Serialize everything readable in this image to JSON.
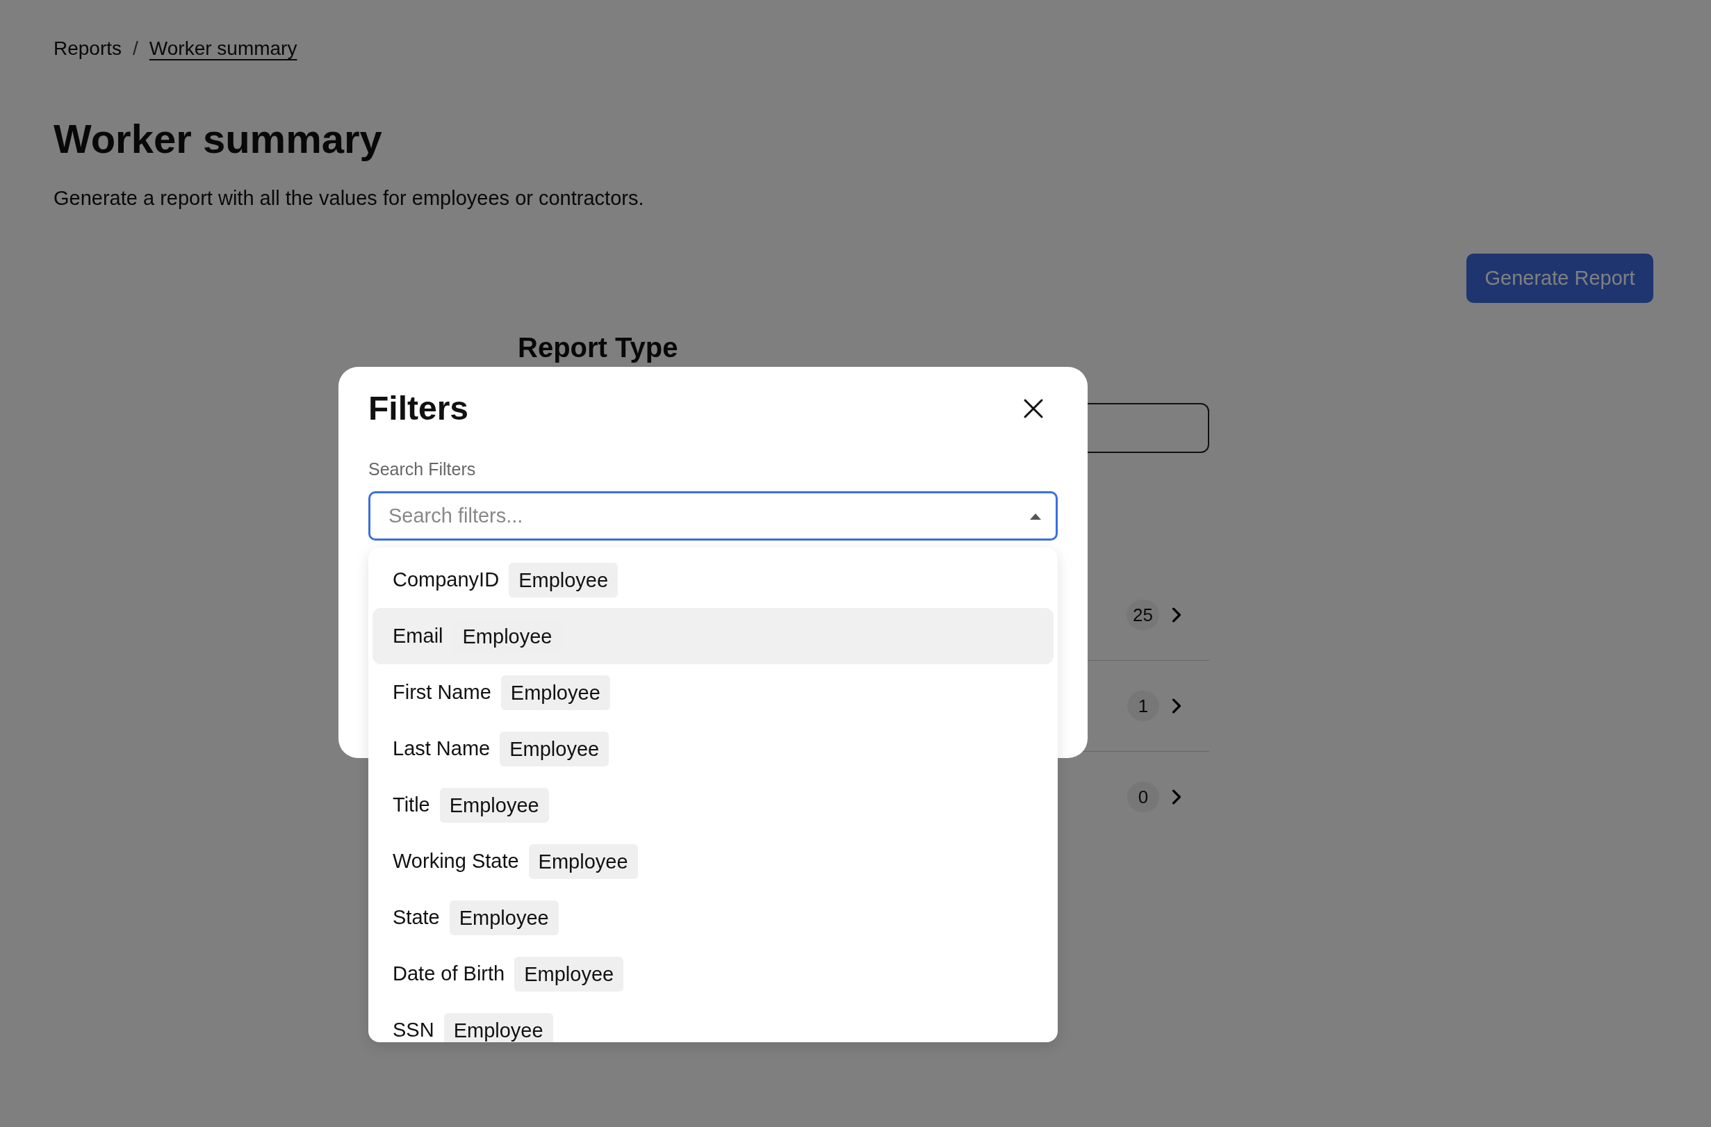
{
  "breadcrumb_separator": "/",
  "breadcrumb": [
    {
      "label": "Reports",
      "current": false
    },
    {
      "label": "Worker summary",
      "current": true
    }
  ],
  "title": "Worker summary",
  "description": "Generate a report with all the values for employees or contractors.",
  "generate_button": "Generate Report",
  "report_type": {
    "heading": "Report Type"
  },
  "rows": [
    {
      "count": "25"
    },
    {
      "count": "1"
    },
    {
      "count": "0"
    }
  ],
  "modal": {
    "title": "Filters",
    "search_label": "Search Filters",
    "placeholder": "Search filters...",
    "options": [
      {
        "name": "CompanyID",
        "tag": "Employee",
        "selected": false
      },
      {
        "name": "Email",
        "tag": "Employee",
        "selected": true
      },
      {
        "name": "First Name",
        "tag": "Employee",
        "selected": false
      },
      {
        "name": "Last Name",
        "tag": "Employee",
        "selected": false
      },
      {
        "name": "Title",
        "tag": "Employee",
        "selected": false
      },
      {
        "name": "Working State",
        "tag": "Employee",
        "selected": false
      },
      {
        "name": "State",
        "tag": "Employee",
        "selected": false
      },
      {
        "name": "Date of Birth",
        "tag": "Employee",
        "selected": false
      },
      {
        "name": "SSN",
        "tag": "Employee",
        "selected": false
      }
    ]
  }
}
